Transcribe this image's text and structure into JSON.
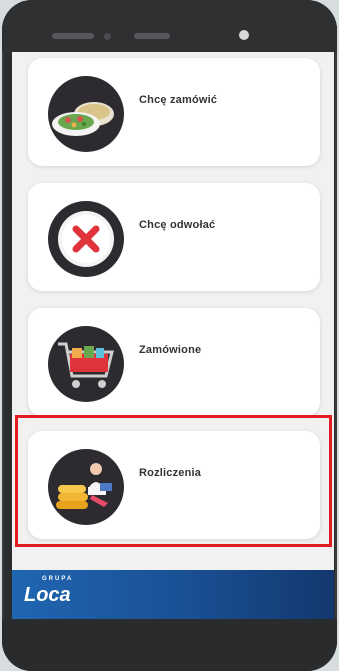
{
  "menu": {
    "items": [
      {
        "label": "Chcę zamówić",
        "icon": "salad-plate-icon"
      },
      {
        "label": "Chcę odwołać",
        "icon": "cancel-x-icon"
      },
      {
        "label": "Zamówione",
        "icon": "shopping-cart-icon"
      },
      {
        "label": "Rozliczenia",
        "icon": "coins-person-icon"
      }
    ]
  },
  "footer": {
    "logo_text": "Loca",
    "logo_subtext": "GRUPA"
  },
  "colors": {
    "highlight": "#e31b23",
    "footer_blue": "#1a4f93",
    "icon_bg": "#2d2b2f"
  }
}
